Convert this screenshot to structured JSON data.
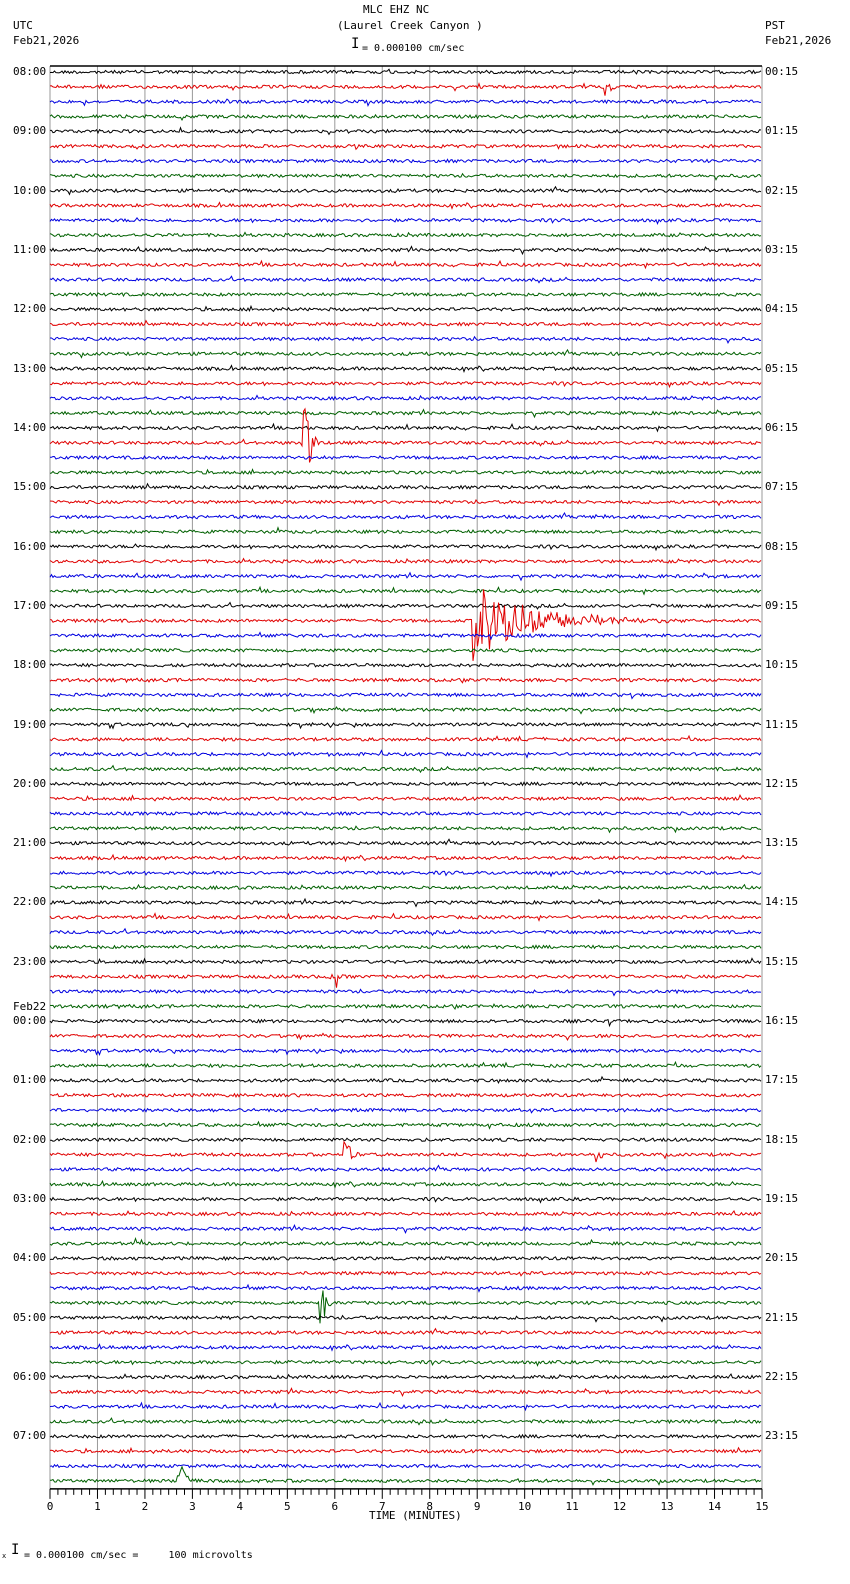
{
  "header": {
    "station": "MLC EHZ NC",
    "location": "(Laurel Creek Canyon )",
    "left_tz": "UTC",
    "left_date": "Feb21,2026",
    "right_tz": "PST",
    "right_date": "Feb21,2026",
    "scale": "= 0.000100 cm/sec"
  },
  "footer": {
    "scale_note": "= 0.000100 cm/sec =     100 microvolts",
    "corner_mark": "x"
  },
  "chart_data": {
    "type": "line",
    "subtype": "helicorder",
    "xlabel": "TIME (MINUTES)",
    "xlim": [
      0,
      15
    ],
    "x_ticks": [
      "0",
      "1",
      "2",
      "3",
      "4",
      "5",
      "6",
      "7",
      "8",
      "9",
      "10",
      "11",
      "12",
      "13",
      "14",
      "15"
    ],
    "rows_per_hour": 4,
    "trace_colors": [
      "#000000",
      "#e00000",
      "#0000e0",
      "#006000"
    ],
    "grid": true,
    "left_labels": [
      "08:00",
      "09:00",
      "10:00",
      "11:00",
      "12:00",
      "13:00",
      "14:00",
      "15:00",
      "16:00",
      "17:00",
      "18:00",
      "19:00",
      "20:00",
      "21:00",
      "22:00",
      "23:00",
      "00:00",
      "01:00",
      "02:00",
      "03:00",
      "04:00",
      "05:00",
      "06:00",
      "07:00"
    ],
    "date_change_label": "Feb22",
    "date_change_hour_index": 16,
    "right_labels": [
      "00:15",
      "01:15",
      "02:15",
      "03:15",
      "04:15",
      "05:15",
      "06:15",
      "07:15",
      "08:15",
      "09:15",
      "10:15",
      "11:15",
      "12:15",
      "13:15",
      "14:15",
      "15:15",
      "16:15",
      "17:15",
      "18:15",
      "19:15",
      "20:15",
      "21:15",
      "22:15",
      "23:15"
    ],
    "events": [
      {
        "row": 1,
        "minute": 11.7,
        "amplitude": 8,
        "duration": 0.3
      },
      {
        "row": 25,
        "minute": 5.3,
        "amplitude": 80,
        "duration": 0.3
      },
      {
        "row": 29,
        "minute": 14.1,
        "amplitude": 6,
        "duration": 0.05
      },
      {
        "row": 30,
        "minute": 3.2,
        "amplitude": 4,
        "duration": 0.05
      },
      {
        "row": 30,
        "minute": 11.5,
        "amplitude": 7,
        "duration": 0.05
      },
      {
        "row": 31,
        "minute": 4.8,
        "amplitude": 8,
        "duration": 0.15
      },
      {
        "row": 31,
        "minute": 12.7,
        "amplitude": 5,
        "duration": 0.05
      },
      {
        "row": 37,
        "minute": 8.9,
        "amplitude": 40,
        "duration": 3.0
      },
      {
        "row": 46,
        "minute": 5.5,
        "amplitude": 3,
        "duration": 0.6
      },
      {
        "row": 61,
        "minute": 5.9,
        "amplitude": 70,
        "duration": 0.2
      },
      {
        "row": 62,
        "minute": 13.2,
        "amplitude": 5,
        "duration": 0.05
      },
      {
        "row": 64,
        "minute": 11.8,
        "amplitude": 5,
        "duration": 0.15
      },
      {
        "row": 73,
        "minute": 6.2,
        "amplitude": 20,
        "duration": 0.3
      },
      {
        "row": 73,
        "minute": 11.5,
        "amplitude": 14,
        "duration": 0.2
      },
      {
        "row": 79,
        "minute": 1.8,
        "amplitude": 6,
        "duration": 0.1
      },
      {
        "row": 83,
        "minute": 5.7,
        "amplitude": 25,
        "duration": 0.3
      },
      {
        "row": 95,
        "minute": 2.7,
        "amplitude": 30,
        "duration": 0.3
      },
      {
        "row": 95,
        "minute": 9.8,
        "amplitude": 6,
        "duration": 0.1
      }
    ]
  }
}
